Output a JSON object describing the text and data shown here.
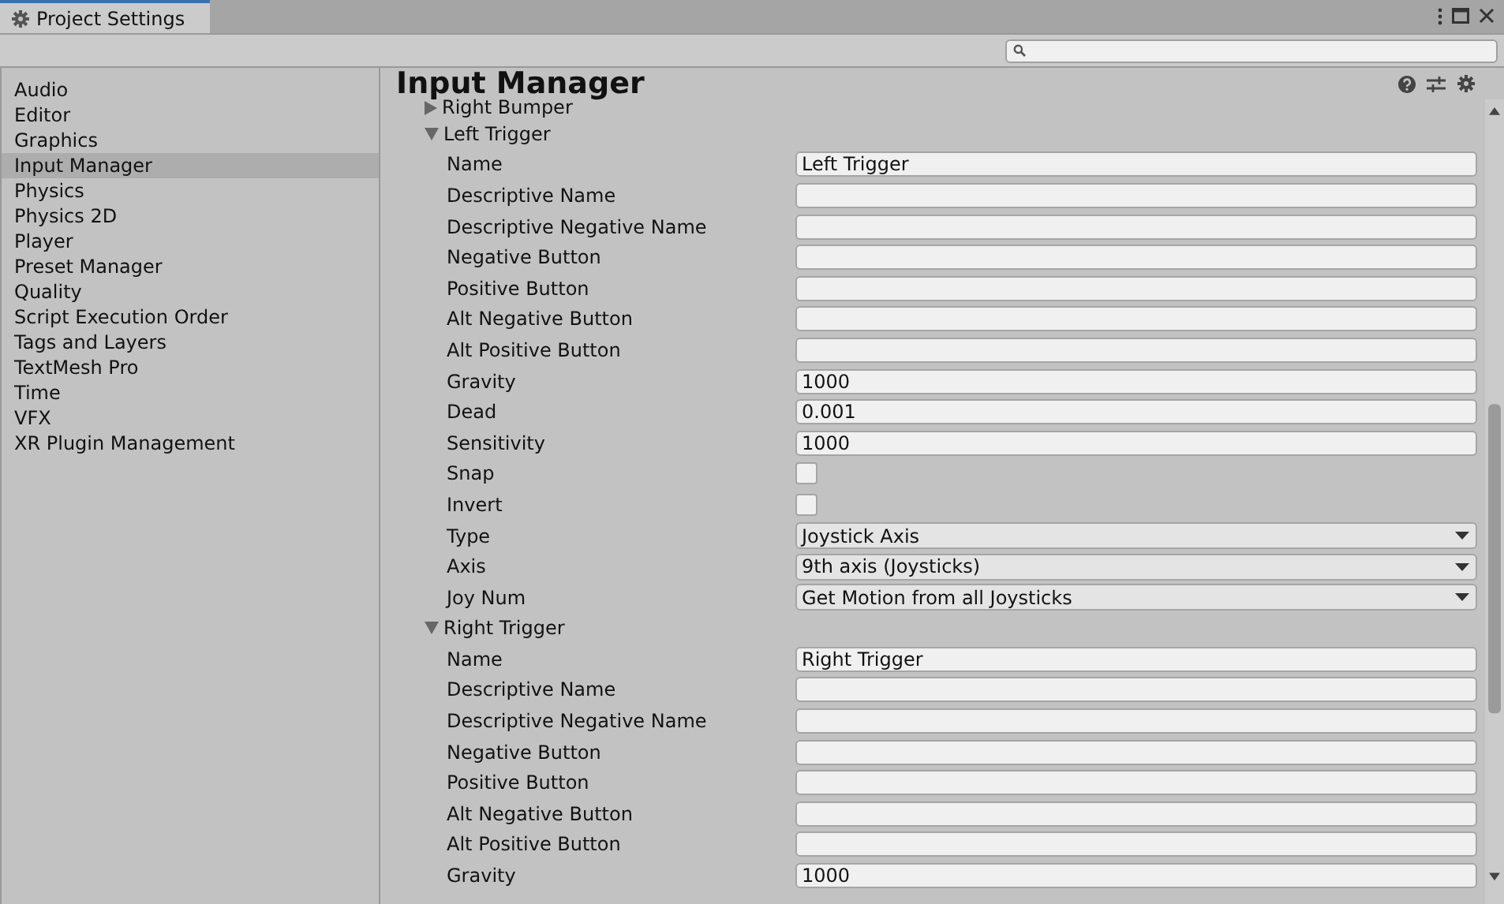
{
  "window": {
    "title": "Project Settings"
  },
  "sidebar": {
    "items": [
      {
        "label": "Audio",
        "selected": false
      },
      {
        "label": "Editor",
        "selected": false
      },
      {
        "label": "Graphics",
        "selected": false
      },
      {
        "label": "Input Manager",
        "selected": true
      },
      {
        "label": "Physics",
        "selected": false
      },
      {
        "label": "Physics 2D",
        "selected": false
      },
      {
        "label": "Player",
        "selected": false
      },
      {
        "label": "Preset Manager",
        "selected": false
      },
      {
        "label": "Quality",
        "selected": false
      },
      {
        "label": "Script Execution Order",
        "selected": false
      },
      {
        "label": "Tags and Layers",
        "selected": false
      },
      {
        "label": "TextMesh Pro",
        "selected": false
      },
      {
        "label": "Time",
        "selected": false
      },
      {
        "label": "VFX",
        "selected": false
      },
      {
        "label": "XR Plugin Management",
        "selected": false
      }
    ]
  },
  "panel": {
    "title": "Input Manager",
    "axes": [
      {
        "name": "Right Bumper",
        "expanded": false
      },
      {
        "name": "Left Trigger",
        "expanded": true,
        "fields": [
          {
            "kind": "text",
            "label": "Name",
            "value": "Left Trigger"
          },
          {
            "kind": "text",
            "label": "Descriptive Name"
          },
          {
            "kind": "text",
            "label": "Descriptive Negative Name"
          },
          {
            "kind": "text",
            "label": "Negative Button"
          },
          {
            "kind": "text",
            "label": "Positive Button"
          },
          {
            "kind": "text",
            "label": "Alt Negative Button"
          },
          {
            "kind": "text",
            "label": "Alt Positive Button"
          },
          {
            "kind": "text",
            "label": "Gravity",
            "value": "1000"
          },
          {
            "kind": "text",
            "label": "Dead",
            "value": "0.001"
          },
          {
            "kind": "text",
            "label": "Sensitivity",
            "value": "1000"
          },
          {
            "kind": "checkbox",
            "label": "Snap",
            "checked": false
          },
          {
            "kind": "checkbox",
            "label": "Invert",
            "checked": false
          },
          {
            "kind": "dropdown",
            "label": "Type",
            "value": "Joystick Axis"
          },
          {
            "kind": "dropdown",
            "label": "Axis",
            "value": "9th axis (Joysticks)"
          },
          {
            "kind": "dropdown",
            "label": "Joy Num",
            "value": "Get Motion from all Joysticks"
          }
        ]
      },
      {
        "name": "Right Trigger",
        "expanded": true,
        "fields": [
          {
            "kind": "text",
            "label": "Name",
            "value": "Right Trigger"
          },
          {
            "kind": "text",
            "label": "Descriptive Name"
          },
          {
            "kind": "text",
            "label": "Descriptive Negative Name"
          },
          {
            "kind": "text",
            "label": "Negative Button"
          },
          {
            "kind": "text",
            "label": "Positive Button"
          },
          {
            "kind": "text",
            "label": "Alt Negative Button"
          },
          {
            "kind": "text",
            "label": "Alt Positive Button"
          },
          {
            "kind": "text",
            "label": "Gravity",
            "value": "1000"
          }
        ]
      }
    ]
  }
}
